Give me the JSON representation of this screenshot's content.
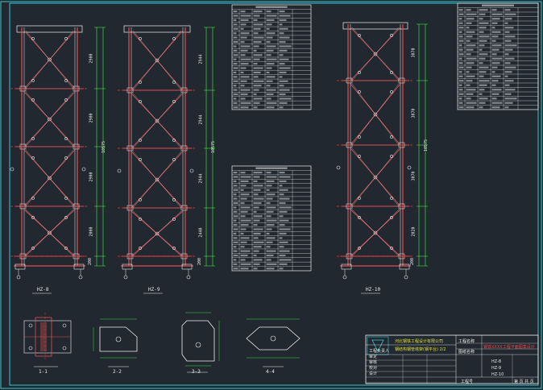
{
  "colors": {
    "background": "#212830",
    "frame": "#38c8d0",
    "member": "#e05050",
    "node": "#f0f0f0",
    "dimension": "#40e040",
    "text": "#e8e8e8",
    "accent_yellow": "#e0e040"
  },
  "towers": [
    {
      "id": "HZ-8",
      "caption": "HZ-8",
      "total_dim": "10575",
      "panel_dims": [
        "2900",
        "2900",
        "2900",
        "2000",
        "200"
      ]
    },
    {
      "id": "HZ-9",
      "caption": "HZ-9",
      "total_dim": "10575",
      "panel_dims": [
        "2944",
        "2944",
        "2944",
        "2440",
        "200"
      ]
    },
    {
      "id": "HZ-10",
      "caption": "HZ-10",
      "total_dim": "10575",
      "panel_dims": [
        "3070",
        "3070",
        "3070",
        "2020",
        "200"
      ]
    }
  ],
  "detail_captions": [
    "1-1",
    "2-2",
    "3-3",
    "4-4"
  ],
  "title_block": {
    "company": "河北钢铁工程设计有限公司",
    "project_label": "工程名称",
    "project_value": "钢铁XXXX工程平面图案设计",
    "drawing_title": "钢结构钢管塔架(钢平台) 2/2",
    "drawing_name_label": "图纸名称",
    "drawing_numbers": [
      "HZ-8",
      "HZ-9",
      "HZ-10"
    ],
    "rows": [
      "工程负责人",
      "审定",
      "审核",
      "校对",
      "设计"
    ],
    "footer_left": "工程号",
    "footer_right": "第 页 共 页"
  },
  "tables": [
    {
      "id": "table-top-center",
      "title": "构件表 (HZ-8)"
    },
    {
      "id": "table-bottom-center",
      "title": "构件表 (HZ-9)"
    },
    {
      "id": "table-top-right",
      "title": "构件表 (HZ-10)"
    }
  ]
}
